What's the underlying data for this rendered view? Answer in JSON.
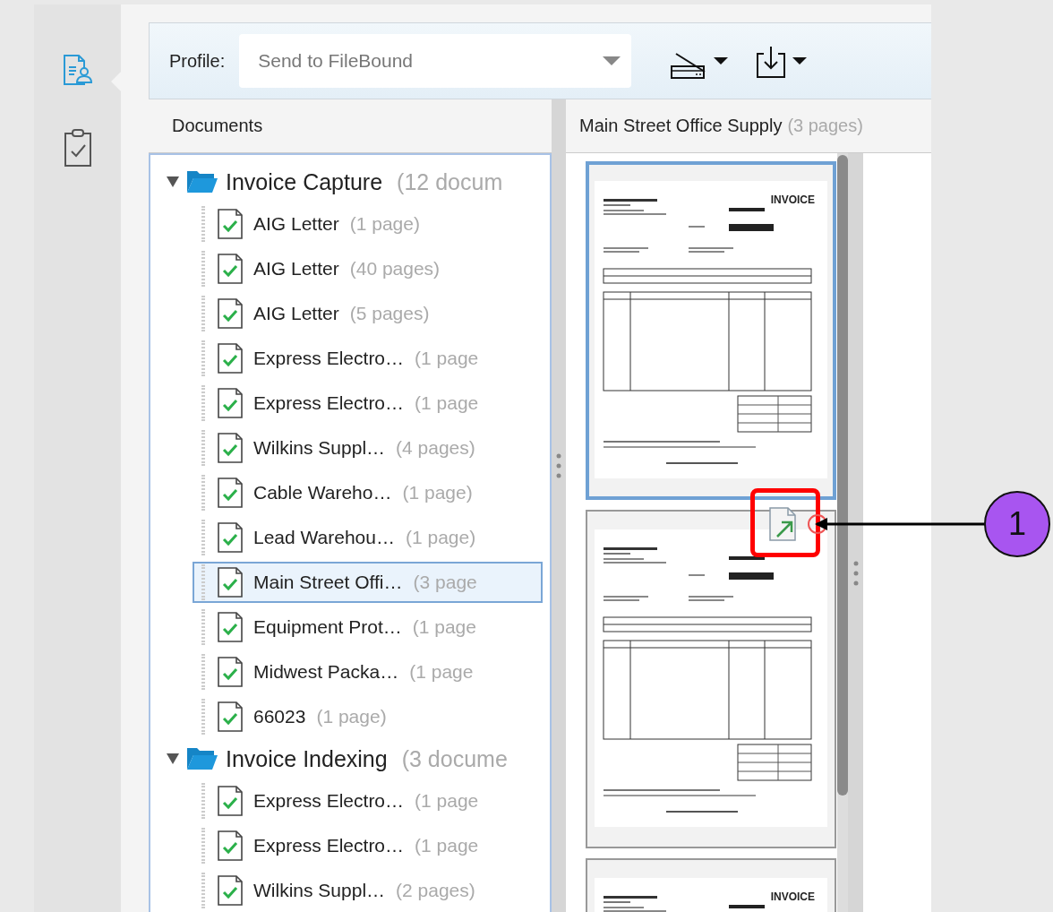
{
  "nav": [
    {
      "kind": "capture",
      "selected": true
    },
    {
      "kind": "review",
      "selected": false
    }
  ],
  "toolbar": {
    "profile_label": "Profile:",
    "profile_value": "Send to FileBound"
  },
  "documents_panel": {
    "title": "Documents",
    "folders": [
      {
        "name": "Invoice Capture",
        "count": "(12 docum",
        "expanded": true,
        "children": [
          {
            "name": "AIG Letter",
            "count": "(1 page)",
            "selected": false
          },
          {
            "name": "AIG Letter",
            "count": "(40 pages)",
            "selected": false
          },
          {
            "name": "AIG Letter",
            "count": "(5 pages)",
            "selected": false
          },
          {
            "name": "Express Electro…",
            "count": "(1 page",
            "selected": false
          },
          {
            "name": "Express Electro…",
            "count": "(1 page",
            "selected": false
          },
          {
            "name": "Wilkins Suppl…",
            "count": "(4 pages)",
            "selected": false
          },
          {
            "name": "Cable Wareho…",
            "count": "(1 page)",
            "selected": false
          },
          {
            "name": "Lead Warehou…",
            "count": "(1 page)",
            "selected": false
          },
          {
            "name": "Main Street Offi…",
            "count": "(3 page",
            "selected": true
          },
          {
            "name": "Equipment Prot…",
            "count": "(1 page",
            "selected": false
          },
          {
            "name": "Midwest Packa…",
            "count": "(1 page",
            "selected": false
          },
          {
            "name": "66023",
            "count": "(1 page)",
            "selected": false
          }
        ]
      },
      {
        "name": "Invoice Indexing",
        "count": "(3 docume",
        "expanded": true,
        "children": [
          {
            "name": "Express Electro…",
            "count": "(1 page",
            "selected": false
          },
          {
            "name": "Express Electro…",
            "count": "(1 page",
            "selected": false
          },
          {
            "name": "Wilkins Suppl…",
            "count": "(2 pages)",
            "selected": false
          }
        ]
      }
    ]
  },
  "preview_panel": {
    "title": "Main Street Office Supply",
    "count": "(3 pages)",
    "pages": [
      {
        "heading": "INVOICE",
        "selected": true,
        "move_handle": false
      },
      {
        "selected": false,
        "move_handle": true
      },
      {
        "heading": "INVOICE",
        "selected": false,
        "move_handle": false
      }
    ]
  },
  "annotation": {
    "label": "1"
  }
}
